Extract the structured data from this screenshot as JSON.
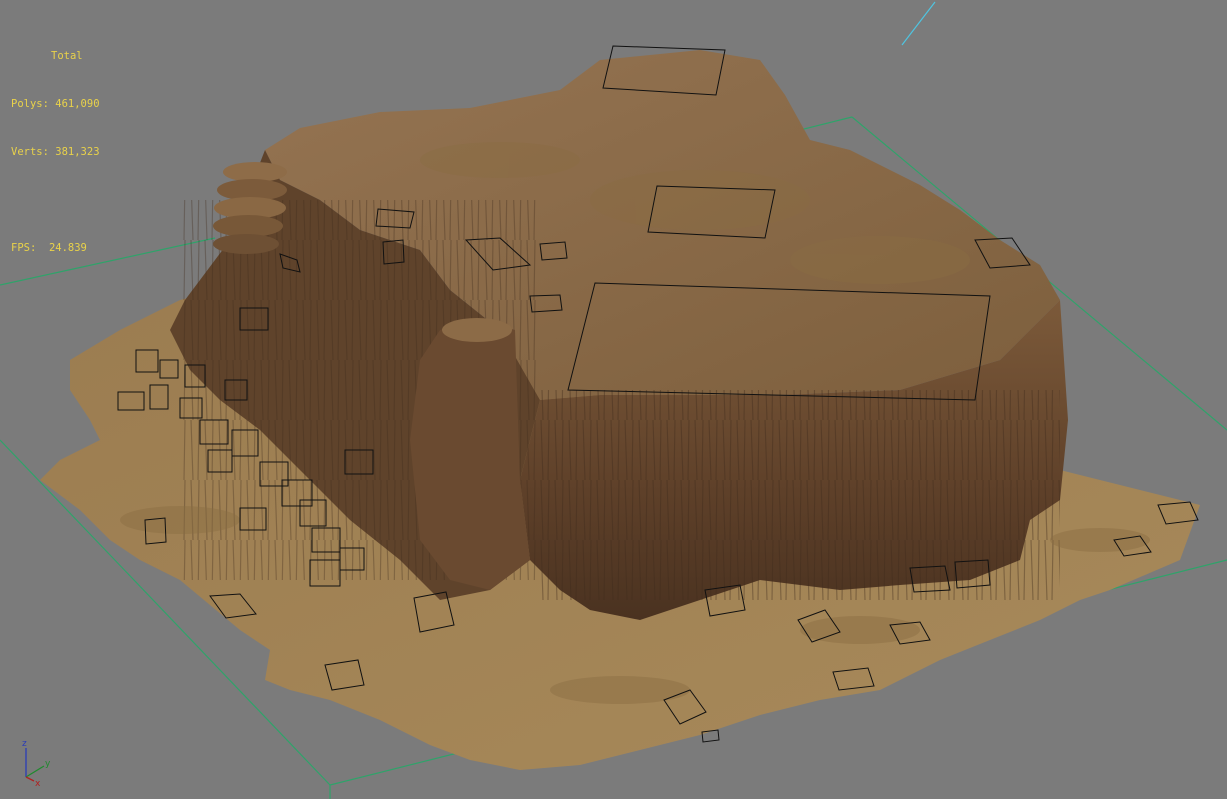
{
  "viewport": {
    "name": "perspective-viewport",
    "stats": {
      "header": "Total",
      "polys_label": "Polys:",
      "polys_value": "461,090",
      "verts_label": "Verts:",
      "verts_value": "381,323",
      "fps_label": "FPS:",
      "fps_value": "24.839"
    },
    "axis_gizmo": {
      "z": "z",
      "y": "y",
      "x": "x"
    },
    "colors": {
      "background": "#7b7b7b",
      "stats_text": "#e9d24a",
      "grid_boundary": "#2fa36a",
      "wire_boxes": "#111111",
      "terrain_sand": "#a48456",
      "cliff_rock": "#6b4a30",
      "mesa_top": "#8a6a44"
    },
    "icons": [
      "axis-gizmo-icon"
    ]
  }
}
